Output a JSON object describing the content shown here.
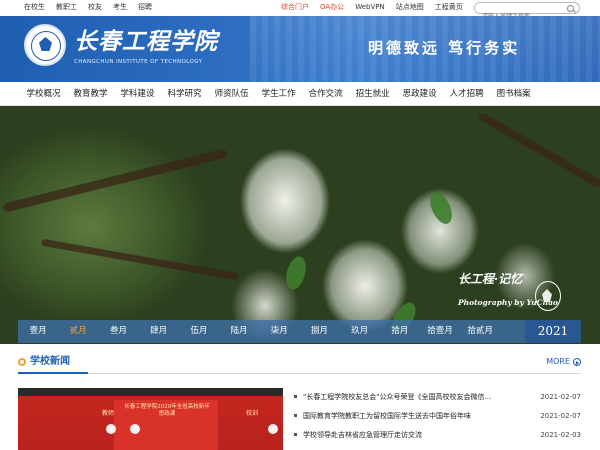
{
  "topbar": {
    "left_links": [
      "在校生",
      "教职工",
      "校友",
      "考生",
      "招聘"
    ],
    "right_links": [
      {
        "label": "综合门户",
        "highlight": true
      },
      {
        "label": "OA办公",
        "highlight": false
      },
      {
        "label": "WebVPN",
        "highlight": false
      },
      {
        "label": "站点地图",
        "highlight": false
      },
      {
        "label": "工程黄页",
        "highlight": false
      }
    ],
    "search_placeholder": "请输入关键字搜索"
  },
  "header": {
    "school_name_cn": "长春工程学院",
    "school_name_en": "CHANGCHUN INSTITUTE OF TECHNOLOGY",
    "motto": "明德致远  笃行务实"
  },
  "nav": {
    "items": [
      "学校概况",
      "教育教学",
      "学科建设",
      "科学研究",
      "师资队伍",
      "学生工作",
      "合作交流",
      "招生就业",
      "思政建设",
      "人才招聘",
      "图书档案"
    ]
  },
  "banner": {
    "signature_cn": "长工程·记忆",
    "signature_en": "Photography by YuChao",
    "months": [
      "壹月",
      "贰月",
      "叁月",
      "肆月",
      "伍月",
      "陆月",
      "柒月",
      "捌月",
      "玖月",
      "拾月",
      "拾壹月",
      "拾贰月"
    ],
    "active_month": "贰月",
    "year": "2021"
  },
  "news": {
    "title": "学校新闻",
    "more_label": "MORE",
    "photo_screen_text": "长春工程学院2020年全省高校新年思政课",
    "photo_left_text": "教师",
    "photo_right_text": "校训",
    "items": [
      {
        "title": "\"长春工程学院校友总会\"公众号荣登《全国高校校友会微信...",
        "date": "2021-02-07"
      },
      {
        "title": "国际教育学院教职工为留校国际学生送去中国年俗年味",
        "date": "2021-02-07"
      },
      {
        "title": "学校领导赴吉林省应急管理厅走访交流",
        "date": "2021-02-03"
      }
    ]
  },
  "colors": {
    "brand_blue": "#1f5fb2",
    "accent_orange": "#f2a23c",
    "highlight_red": "#e7472a"
  }
}
